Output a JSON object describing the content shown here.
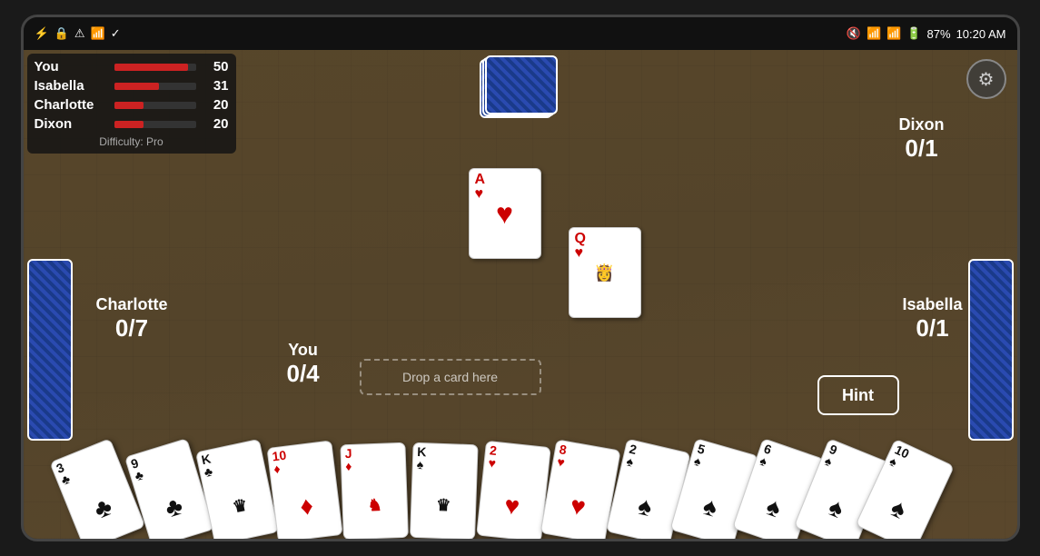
{
  "statusBar": {
    "time": "10:20 AM",
    "battery": "87%",
    "signal": "4G"
  },
  "scores": [
    {
      "name": "You",
      "value": "50",
      "barWidth": "90"
    },
    {
      "name": "Isabella",
      "value": "31",
      "barWidth": "55"
    },
    {
      "name": "Charlotte",
      "value": "20",
      "barWidth": "36"
    },
    {
      "name": "Dixon",
      "value": "20",
      "barWidth": "36"
    }
  ],
  "difficulty": "Difficulty: Pro",
  "players": {
    "charlotte": {
      "name": "Charlotte",
      "score": "0/7"
    },
    "you": {
      "name": "You",
      "score": "0/4"
    },
    "isabella": {
      "name": "Isabella",
      "score": "0/1"
    },
    "dixon": {
      "name": "Dixon",
      "score": "0/1"
    }
  },
  "dropZone": "Drop a card here",
  "hintButton": "Hint",
  "tableCards": [
    {
      "rank": "A",
      "suit": "♥",
      "color": "red"
    },
    {
      "rank": "Q",
      "suit": "♥",
      "color": "red"
    }
  ],
  "handCards": [
    {
      "rank": "3",
      "suit": "♣",
      "color": "black"
    },
    {
      "rank": "9",
      "suit": "♣",
      "color": "black"
    },
    {
      "rank": "K",
      "suit": "♣",
      "color": "black"
    },
    {
      "rank": "10",
      "suit": "♦",
      "color": "red"
    },
    {
      "rank": "J",
      "suit": "♦",
      "color": "red"
    },
    {
      "rank": "K",
      "suit": "♠",
      "color": "black"
    },
    {
      "rank": "2",
      "suit": "♥",
      "color": "red"
    },
    {
      "rank": "8",
      "suit": "♥",
      "color": "red"
    },
    {
      "rank": "2",
      "suit": "♠",
      "color": "black"
    },
    {
      "rank": "5",
      "suit": "♠",
      "color": "black"
    },
    {
      "rank": "6",
      "suit": "♠",
      "color": "black"
    },
    {
      "rank": "9",
      "suit": "♠",
      "color": "black"
    },
    {
      "rank": "10",
      "suit": "♠",
      "color": "black"
    }
  ]
}
